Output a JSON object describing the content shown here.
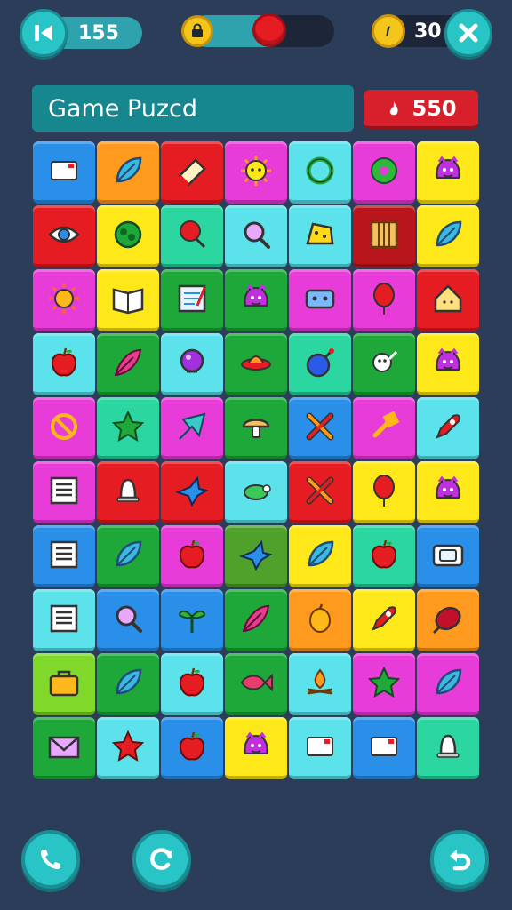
{
  "hud": {
    "moves_value": "155",
    "progress_fraction": 0.55,
    "coins_value": "30"
  },
  "title": "Game Puzcd",
  "score": "550",
  "colors": {
    "blue": "#2a8fe8",
    "orange": "#ff9a1f",
    "red": "#e51c22",
    "magenta": "#e83cd8",
    "cyan": "#5ce2ea",
    "yellow": "#ffe81a",
    "green": "#1ea83a",
    "teal": "#2cd6a0",
    "lime": "#7fd82a",
    "darkred": "#b8161c",
    "purple": "#c030e0",
    "olive": "#4fa12c"
  },
  "grid": [
    [
      {
        "c": "blue",
        "i": "card-icon"
      },
      {
        "c": "orange",
        "i": "leaf-icon"
      },
      {
        "c": "red",
        "i": "eraser-icon"
      },
      {
        "c": "magenta",
        "i": "sun-face-icon"
      },
      {
        "c": "cyan",
        "i": "ring-icon"
      },
      {
        "c": "magenta",
        "i": "donut-icon"
      },
      {
        "c": "yellow",
        "i": "monster-icon"
      }
    ],
    [
      {
        "c": "red",
        "i": "eye-icon"
      },
      {
        "c": "yellow",
        "i": "bush-icon"
      },
      {
        "c": "teal",
        "i": "lollipop-icon"
      },
      {
        "c": "cyan",
        "i": "magnifier-icon"
      },
      {
        "c": "cyan",
        "i": "cheese-icon"
      },
      {
        "c": "darkred",
        "i": "crate-icon"
      },
      {
        "c": "yellow",
        "i": "leaf-icon"
      }
    ],
    [
      {
        "c": "magenta",
        "i": "sun-icon"
      },
      {
        "c": "yellow",
        "i": "book-icon"
      },
      {
        "c": "green",
        "i": "notepad-icon"
      },
      {
        "c": "green",
        "i": "monster-icon"
      },
      {
        "c": "magenta",
        "i": "robot-icon"
      },
      {
        "c": "magenta",
        "i": "balloon-icon"
      },
      {
        "c": "red",
        "i": "house-icon"
      }
    ],
    [
      {
        "c": "cyan",
        "i": "apple-icon"
      },
      {
        "c": "green",
        "i": "feather-icon"
      },
      {
        "c": "cyan",
        "i": "orb-icon"
      },
      {
        "c": "green",
        "i": "ufo-icon"
      },
      {
        "c": "teal",
        "i": "bomb-icon"
      },
      {
        "c": "green",
        "i": "ghost-icon"
      },
      {
        "c": "yellow",
        "i": "monster-icon"
      }
    ],
    [
      {
        "c": "magenta",
        "i": "no-sign-icon"
      },
      {
        "c": "teal",
        "i": "star-icon"
      },
      {
        "c": "magenta",
        "i": "arrow-leaf-icon"
      },
      {
        "c": "green",
        "i": "mushroom-icon"
      },
      {
        "c": "blue",
        "i": "cross-tools-icon"
      },
      {
        "c": "magenta",
        "i": "wrench-icon"
      },
      {
        "c": "cyan",
        "i": "rocket-icon"
      }
    ],
    [
      {
        "c": "magenta",
        "i": "list-icon"
      },
      {
        "c": "red",
        "i": "bell-icon"
      },
      {
        "c": "red",
        "i": "bird-icon"
      },
      {
        "c": "cyan",
        "i": "turtle-icon"
      },
      {
        "c": "red",
        "i": "cross-tools-icon"
      },
      {
        "c": "yellow",
        "i": "balloon-icon"
      },
      {
        "c": "yellow",
        "i": "monster-icon"
      }
    ],
    [
      {
        "c": "blue",
        "i": "list-icon"
      },
      {
        "c": "green",
        "i": "leaf-icon"
      },
      {
        "c": "magenta",
        "i": "apple-icon"
      },
      {
        "c": "olive",
        "i": "bird-icon"
      },
      {
        "c": "yellow",
        "i": "leaf-icon"
      },
      {
        "c": "teal",
        "i": "apple-icon"
      },
      {
        "c": "blue",
        "i": "camera-icon"
      }
    ],
    [
      {
        "c": "cyan",
        "i": "list-icon"
      },
      {
        "c": "blue",
        "i": "magnifier-icon"
      },
      {
        "c": "blue",
        "i": "sprout-icon"
      },
      {
        "c": "green",
        "i": "feather-icon"
      },
      {
        "c": "orange",
        "i": "mango-icon"
      },
      {
        "c": "yellow",
        "i": "rocket-icon"
      },
      {
        "c": "orange",
        "i": "meat-icon"
      }
    ],
    [
      {
        "c": "lime",
        "i": "briefcase-icon"
      },
      {
        "c": "green",
        "i": "leaf-icon"
      },
      {
        "c": "cyan",
        "i": "apple-icon"
      },
      {
        "c": "green",
        "i": "fish-icon"
      },
      {
        "c": "cyan",
        "i": "campfire-icon"
      },
      {
        "c": "magenta",
        "i": "star-icon"
      },
      {
        "c": "magenta",
        "i": "leaf-icon"
      }
    ],
    [
      {
        "c": "green",
        "i": "envelope-icon"
      },
      {
        "c": "cyan",
        "i": "star-icon"
      },
      {
        "c": "blue",
        "i": "apple-icon"
      },
      {
        "c": "yellow",
        "i": "monster-icon"
      },
      {
        "c": "cyan",
        "i": "card-icon"
      },
      {
        "c": "blue",
        "i": "card-icon"
      },
      {
        "c": "teal",
        "i": "bell-icon"
      }
    ]
  ]
}
